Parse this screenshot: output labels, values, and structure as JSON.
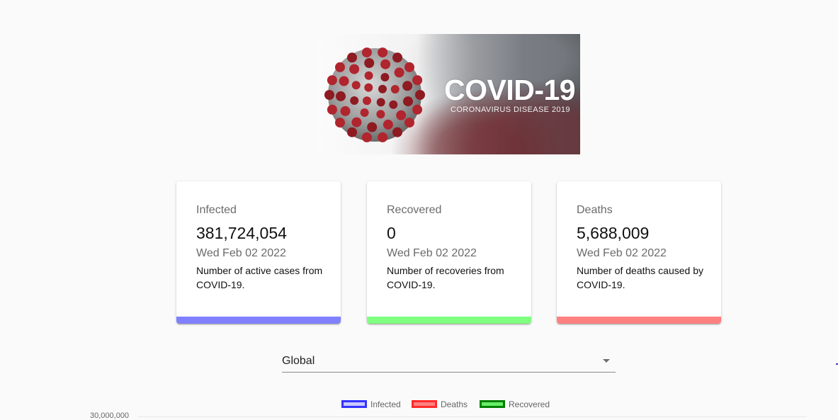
{
  "banner": {
    "title": "COVID-19",
    "subtitle": "CORONAVIRUS DISEASE 2019"
  },
  "cards": [
    {
      "title": "Infected",
      "value": "381,724,054",
      "date": "Wed Feb 02 2022",
      "description": "Number of active cases from COVID-19.",
      "color": "#8080ff"
    },
    {
      "title": "Recovered",
      "value": "0",
      "date": "Wed Feb 02 2022",
      "description": "Number of recoveries from COVID-19.",
      "color": "#80ff80"
    },
    {
      "title": "Deaths",
      "value": "5,688,009",
      "date": "Wed Feb 02 2022",
      "description": "Number of deaths caused by COVID-19.",
      "color": "#ff8080"
    }
  ],
  "country_select": {
    "selected": "Global"
  },
  "chart_data": {
    "type": "line",
    "legend": [
      {
        "name": "Infected",
        "border": "#3333ff",
        "fill": "#c8c8ff"
      },
      {
        "name": "Deaths",
        "border": "#ff2a2a",
        "fill": "#ff8080"
      },
      {
        "name": "Recovered",
        "border": "#008000",
        "fill": "#66ee66"
      }
    ],
    "y_tick_top": "30,000,000"
  }
}
